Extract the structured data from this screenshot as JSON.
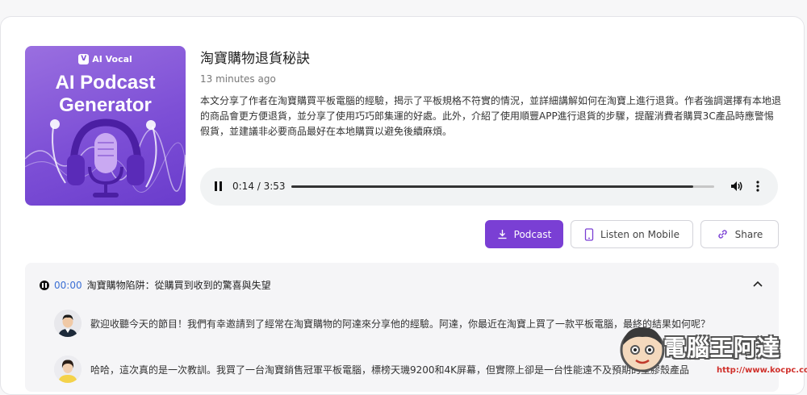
{
  "cover": {
    "brand": "AI Vocal",
    "title_line1": "AI Podcast",
    "title_line2": "Generator"
  },
  "episode": {
    "title": "淘寶購物退貨秘訣",
    "timestamp": "13 minutes ago",
    "summary": "本文分享了作者在淘寶購買平板電腦的經驗，揭示了平板規格不符實的情況，並詳細講解如何在淘寶上進行退貨。作者強調選擇有本地退的商品會更方便退貨，並分享了使用巧巧郎集運的好處。此外，介紹了使用順豐APP進行退貨的步驟，提醒消費者購買3C產品時應警惕假貨，並建議非必要商品最好在本地購買以避免後續麻煩。"
  },
  "player": {
    "time_display": "0:14 / 3:53",
    "progress": 0.95,
    "state": "playing"
  },
  "actions": {
    "podcast_label": "Podcast",
    "mobile_label": "Listen on Mobile",
    "share_label": "Share"
  },
  "transcript": {
    "chapter_time": "00:00",
    "chapter_title": "淘寶購物陷阱：從購買到收到的驚喜與失望",
    "messages": [
      {
        "text": "歡迎收聽今天的節目！我們有幸邀請到了經常在淘寶購物的阿達來分享他的經驗。阿達，你最近在淘寶上買了一款平板電腦，最終的結果如何呢？"
      },
      {
        "text": "哈哈，這次真的是一次教訓。我買了一台淘寶銷售冠軍平板電腦，標榜天璣9200和4K屏幕，但實際上卻是一台性能遠不及預期的塑膠殼產品"
      }
    ]
  },
  "watermark": {
    "text": "電腦王阿達",
    "url": "http://www.kocpc.com.tw"
  },
  "colors": {
    "accent": "#7a3fd4",
    "link_time": "#3b6fd4"
  }
}
